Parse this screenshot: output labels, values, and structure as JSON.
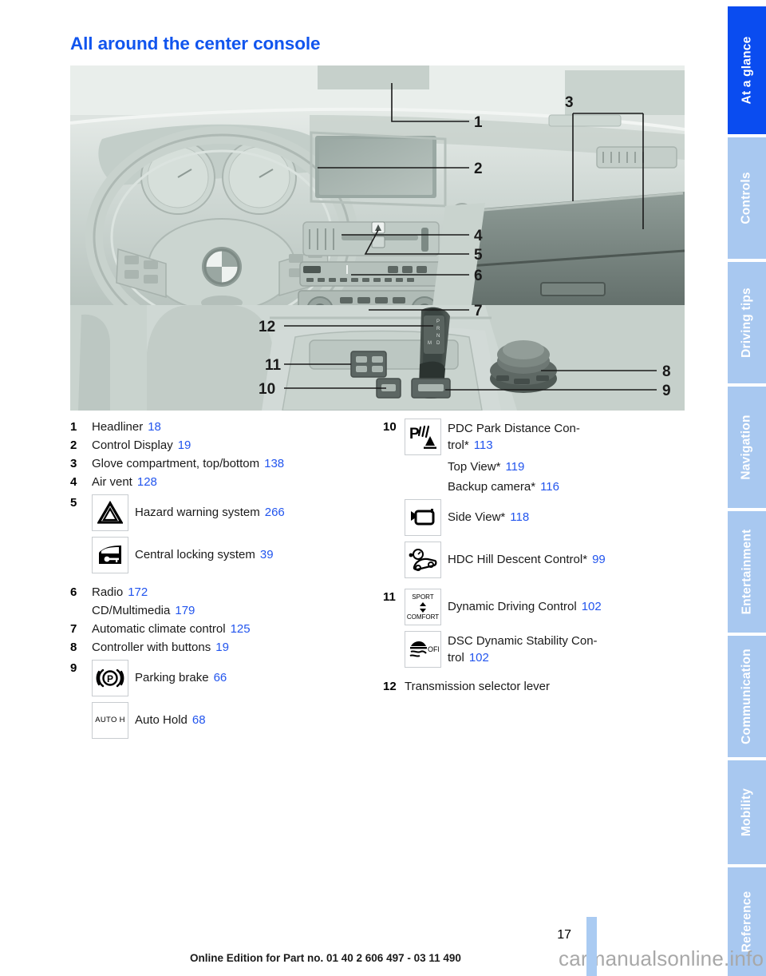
{
  "document": {
    "title": "All around the center console",
    "page_number": "17",
    "footer_note": "Online Edition for Part no. 01 40 2 606 497 - 03 11 490",
    "watermark": "carmanualsonline.info",
    "accent_blue": "#1155ee",
    "link_blue": "#2255ee",
    "tab_active_blue": "#0a4cf0",
    "tab_inactive_blue": "#a8c8f0"
  },
  "sidebar": {
    "tabs": [
      {
        "label": "At a glance",
        "active": true
      },
      {
        "label": "Controls",
        "active": false
      },
      {
        "label": "Driving tips",
        "active": false
      },
      {
        "label": "Navigation",
        "active": false
      },
      {
        "label": "Entertainment",
        "active": false
      },
      {
        "label": "Communication",
        "active": false
      },
      {
        "label": "Mobility",
        "active": false
      },
      {
        "label": "Reference",
        "active": false
      }
    ]
  },
  "illustration": {
    "alt": "BMW dashboard and center console interior view with numbered callouts",
    "callouts": [
      "1",
      "2",
      "3",
      "4",
      "5",
      "6",
      "7",
      "8",
      "9",
      "10",
      "11",
      "12"
    ]
  },
  "legend": {
    "left": [
      {
        "num": "1",
        "label": "Headliner",
        "page": "18"
      },
      {
        "num": "2",
        "label": "Control Display",
        "page": "19"
      },
      {
        "num": "3",
        "label": "Glove compartment, top/bottom",
        "page": "138"
      },
      {
        "num": "4",
        "label": "Air vent",
        "page": "128"
      },
      {
        "num": "5",
        "icon": "hazard-warning-triangle-icon",
        "label": "Hazard warning system",
        "page": "266"
      },
      {
        "num": "",
        "icon": "central-locking-door-key-icon",
        "label": "Central locking system",
        "page": "39"
      },
      {
        "num": "6",
        "label": "Radio",
        "page": "172"
      },
      {
        "num": "",
        "label": "CD/Multimedia",
        "page": "179"
      },
      {
        "num": "7",
        "label": "Automatic climate control",
        "page": "125"
      },
      {
        "num": "8",
        "label": "Controller with buttons",
        "page": "19"
      },
      {
        "num": "9",
        "icon": "parking-brake-icon",
        "label": "Parking brake",
        "page": "66"
      },
      {
        "num": "",
        "icon": "auto-hold-icon",
        "label": "Auto Hold",
        "page": "68"
      }
    ],
    "right": [
      {
        "num": "10",
        "icon": "pdc-park-distance-icon",
        "label": "PDC Park Distance Con-\ntrol*",
        "page": "113"
      },
      {
        "num": "",
        "label": "Top View*",
        "page": "119"
      },
      {
        "num": "",
        "label": "Backup camera*",
        "page": "116"
      },
      {
        "num": "",
        "icon": "side-view-camera-icon",
        "label": "Side View*",
        "page": "118"
      },
      {
        "num": "",
        "icon": "hdc-hill-descent-icon",
        "label": "HDC Hill Descent Control*",
        "page": "99"
      },
      {
        "num": "11",
        "icon": "dynamic-driving-control-icon",
        "label": "Dynamic Driving Control",
        "page": "102"
      },
      {
        "num": "",
        "icon": "dsc-off-icon",
        "label": "DSC Dynamic Stability Con-\ntrol",
        "page": "102"
      },
      {
        "num": "12",
        "label": "Transmission selector lever",
        "page": ""
      }
    ],
    "icon_labels": {
      "dynamic_driving_sport": "SPORT",
      "dynamic_driving_comfort": "COMFORT",
      "auto_hold": "AUTO H",
      "dsc_off": "OFF"
    }
  }
}
